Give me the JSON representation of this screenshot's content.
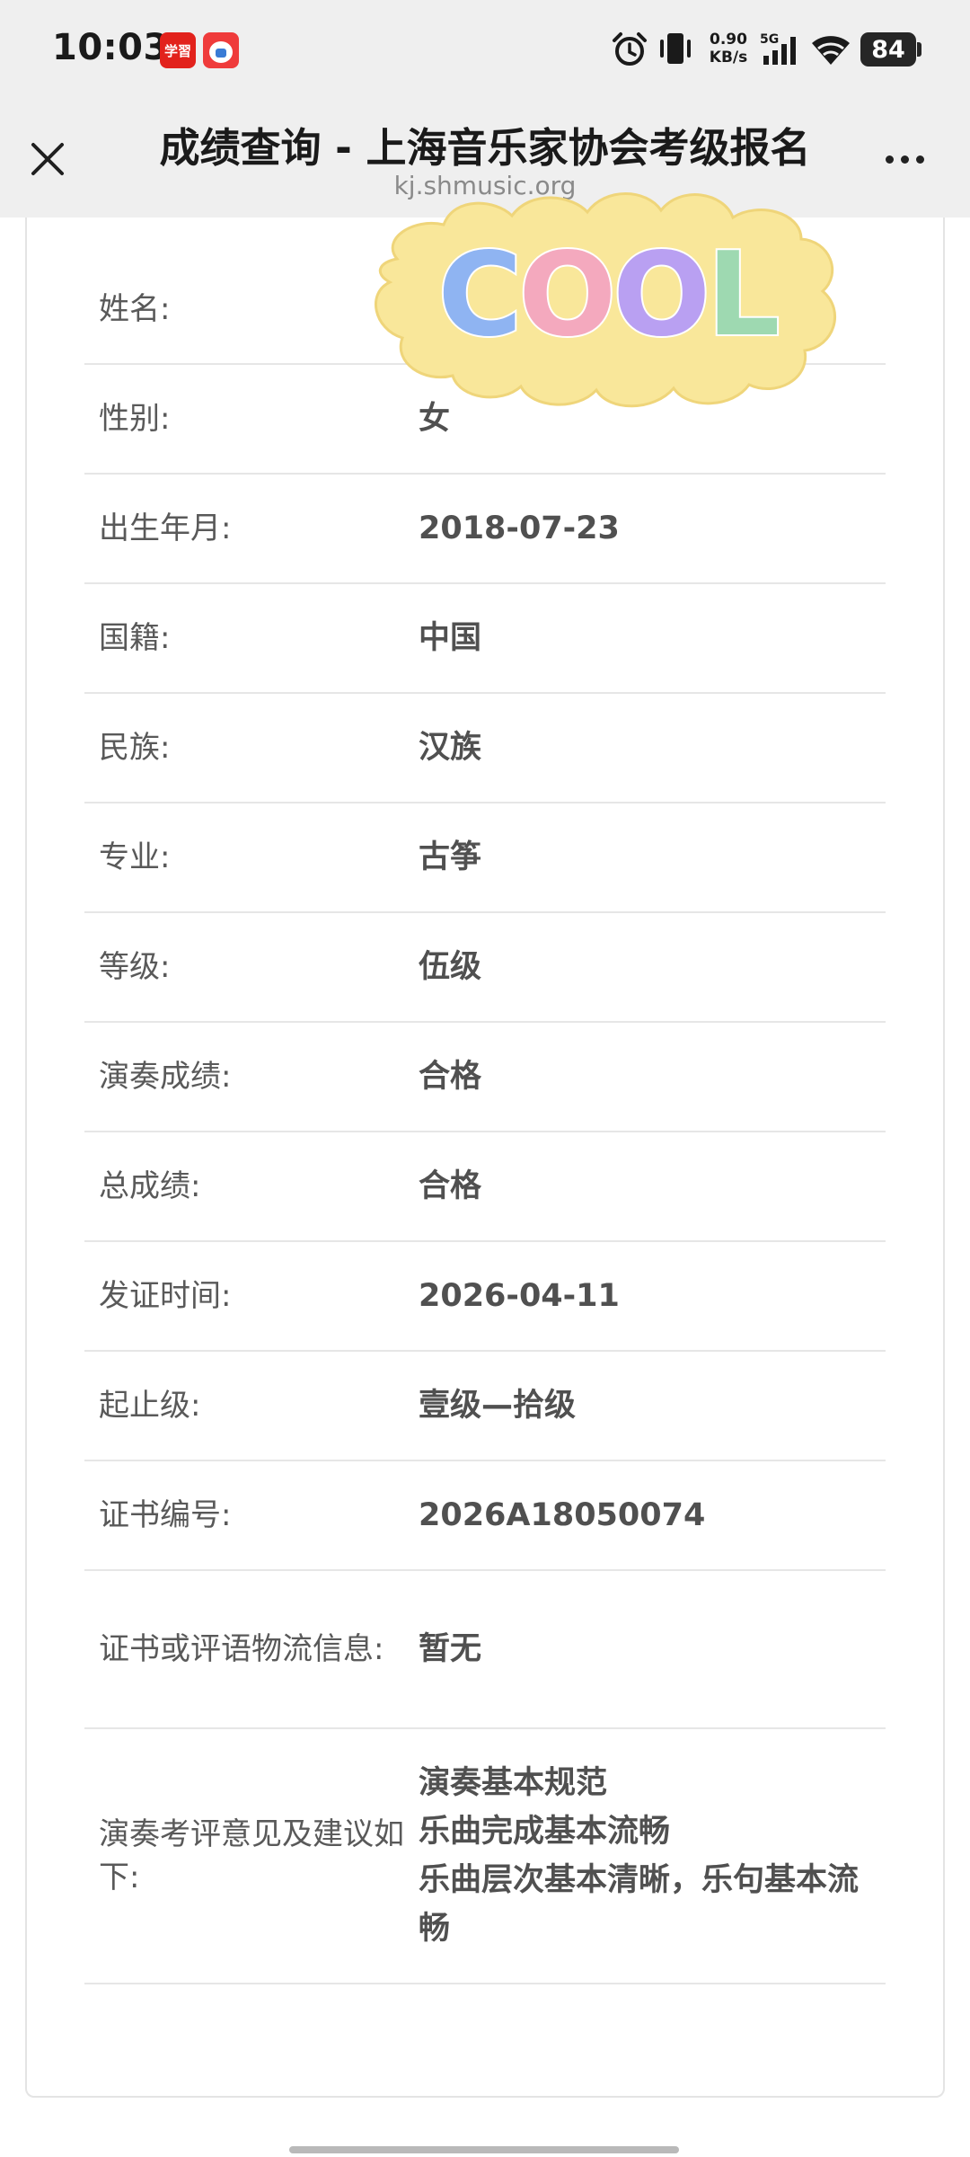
{
  "status_bar": {
    "time": "10:03",
    "app_badge_1": "学習",
    "net_speed_value": "0.90",
    "net_speed_unit": "KB/s",
    "network_type": "5G",
    "battery_level": "84",
    "icons": [
      "alarm-icon",
      "vibrate-icon",
      "signal-icon",
      "wifi-icon"
    ]
  },
  "title_bar": {
    "title": "成绩查询 - 上海音乐家协会考级报名",
    "url": "kj.shmusic.org"
  },
  "sticker": {
    "text": "COOL",
    "letter_colors": [
      "#8fb4f2",
      "#f4a9be",
      "#b9a0f2",
      "#9ed9b1"
    ],
    "blob_color": "#f9e79a"
  },
  "rows": [
    {
      "label": "姓名:",
      "value": ""
    },
    {
      "label": "性别:",
      "value": "女"
    },
    {
      "label": "出生年月:",
      "value": "2018-07-23"
    },
    {
      "label": "国籍:",
      "value": "中国"
    },
    {
      "label": "民族:",
      "value": "汉族"
    },
    {
      "label": "专业:",
      "value": "古筝"
    },
    {
      "label": "等级:",
      "value": "伍级"
    },
    {
      "label": "演奏成绩:",
      "value": "合格"
    },
    {
      "label": "总成绩:",
      "value": "合格"
    },
    {
      "label": "发证时间:",
      "value": "2026-04-11"
    },
    {
      "label": "起止级:",
      "value": "壹级—拾级"
    },
    {
      "label": "证书编号:",
      "value": "2026A18050074"
    },
    {
      "label": "证书或评语物流信息:",
      "value": "暂无"
    },
    {
      "label": "演奏考评意见及建议如下:",
      "value": "演奏基本规范\n乐曲完成基本流畅\n乐曲层次基本清晰，乐句基本流畅"
    }
  ]
}
